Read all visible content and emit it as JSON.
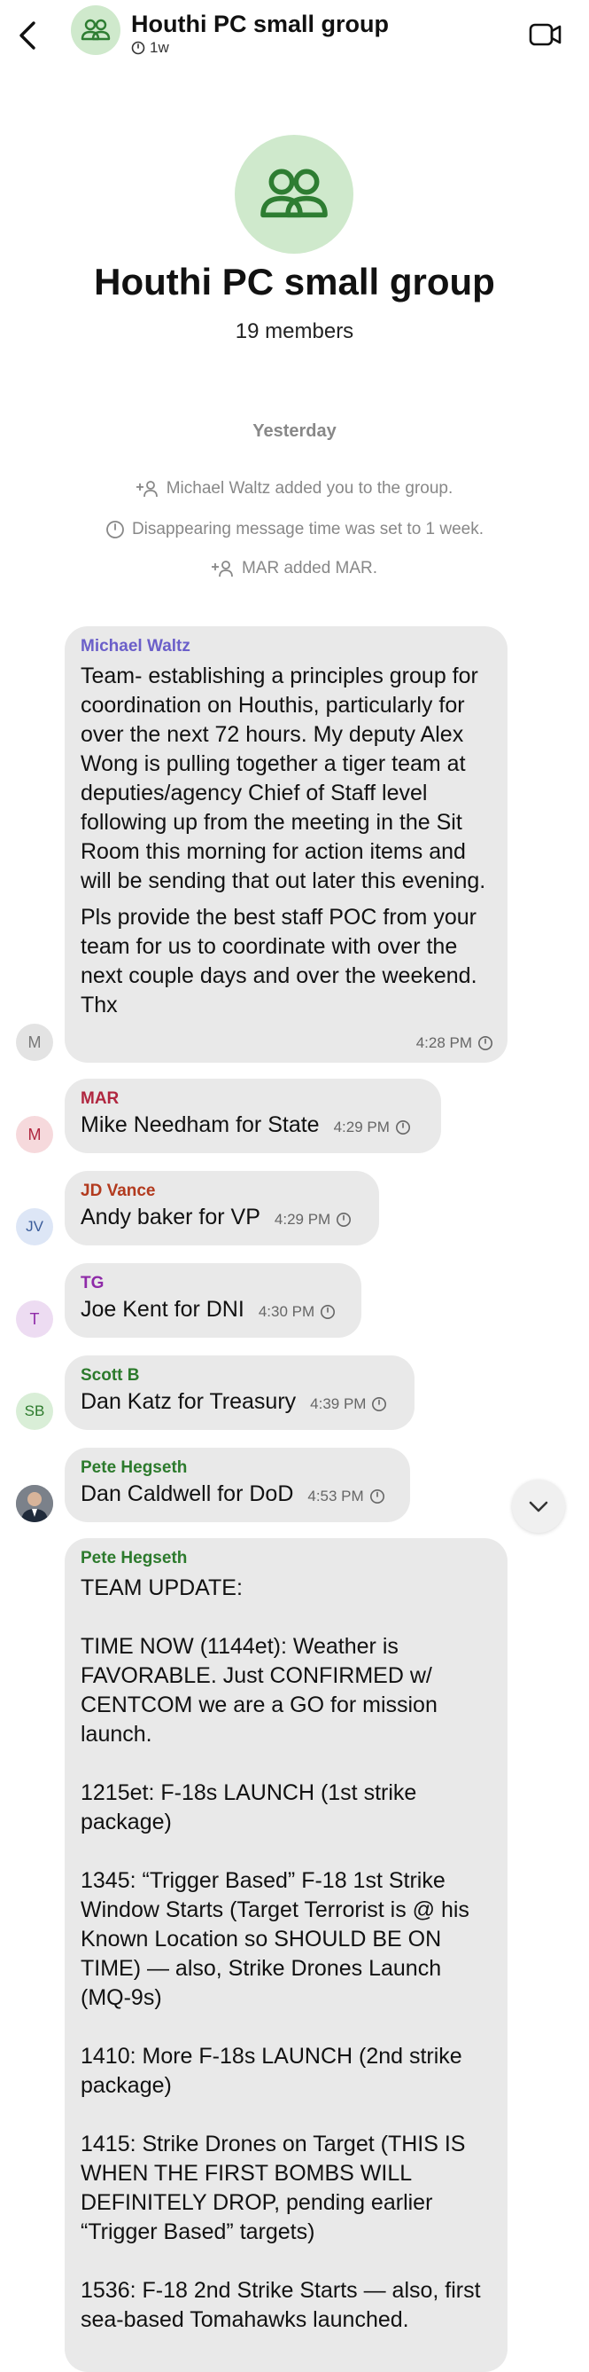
{
  "header": {
    "title": "Houthi PC small group",
    "timer": "1w"
  },
  "group": {
    "name": "Houthi PC small group",
    "members": "19 members"
  },
  "date_separator": "Yesterday",
  "system_messages": [
    "Michael Waltz added you to the group.",
    "Disappearing message time was set to 1 week.",
    "MAR added MAR."
  ],
  "messages": [
    {
      "sender": "Michael Waltz",
      "sender_color": "#6b5fc9",
      "avatar": "M",
      "paragraphs": [
        "Team- establishing a principles group for coordination on Houthis, particularly for over the next 72 hours. My deputy Alex Wong is pulling together a tiger team at deputies/agency Chief of Staff level following up from the meeting in the Sit Room this morning for action items and will be sending that out later this evening.",
        "Pls provide the best staff POC from your team for us to coordinate with over the next couple days and over the weekend. Thx"
      ],
      "time": "4:28 PM"
    },
    {
      "sender": "MAR",
      "sender_color": "#b0263f",
      "avatar": "M",
      "text": "Mike Needham for State",
      "time": "4:29 PM"
    },
    {
      "sender": "JD Vance",
      "sender_color": "#b23a1e",
      "avatar": "JV",
      "text": "Andy baker for VP",
      "time": "4:29 PM"
    },
    {
      "sender": "TG",
      "sender_color": "#8e2aa8",
      "avatar": "T",
      "text": "Joe Kent for DNI",
      "time": "4:30 PM"
    },
    {
      "sender": "Scott B",
      "sender_color": "#2c7a2c",
      "avatar": "SB",
      "text": "Dan Katz for Treasury",
      "time": "4:39 PM"
    },
    {
      "sender": "Pete Hegseth",
      "sender_color": "#2c7a2c",
      "text": "Dan Caldwell for DoD",
      "time": "4:53 PM"
    },
    {
      "sender": "Pete Hegseth",
      "sender_color": "#2c7a2c",
      "lines": [
        "TEAM UPDATE:",
        "",
        "TIME NOW (1144et): Weather is",
        "FAVORABLE. Just CONFIRMED w/",
        "CENTCOM we are a GO for mission",
        "launch.",
        "",
        "1215et: F-18s LAUNCH (1st strike",
        "package)",
        "",
        "1345: “Trigger Based” F-18 1st Strike",
        "Window Starts (Target Terrorist is @ his",
        "Known Location so SHOULD BE ON",
        "TIME) — also, Strike Drones Launch",
        "(MQ-9s)",
        "",
        "1410: More F-18s LAUNCH (2nd strike",
        "package)",
        "",
        "1415: Strike Drones on Target (THIS IS",
        "WHEN THE FIRST BOMBS WILL",
        "DEFINITELY DROP, pending earlier",
        "“Trigger Based” targets)",
        "",
        "1536: F-18 2nd Strike Starts — also, first",
        "sea-based Tomahawks launched."
      ]
    }
  ],
  "colors": {
    "bubble": "#e9e9e9",
    "group_avatar_bg": "#cfe9cc",
    "group_icon": "#2e7d32"
  },
  "icons": [
    "back-chevron-icon",
    "group-icon",
    "timer-icon",
    "video-call-icon",
    "add-person-icon",
    "chevron-down-icon"
  ]
}
